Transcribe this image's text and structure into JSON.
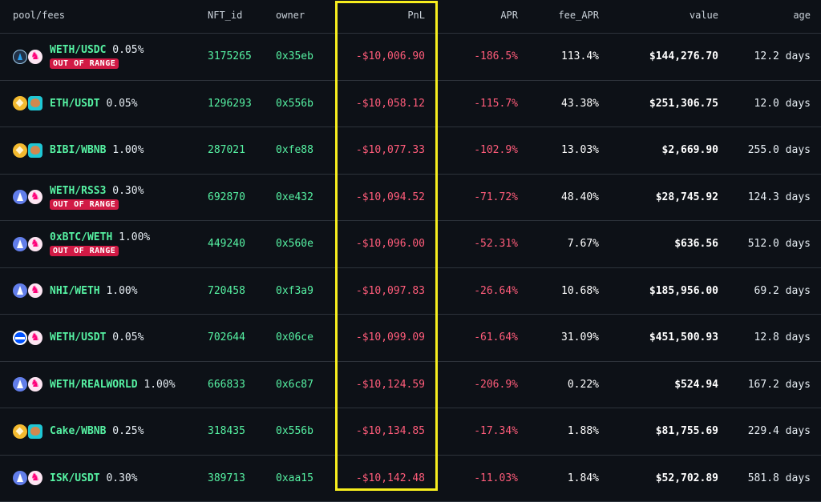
{
  "headers": {
    "pool": "pool/fees",
    "nft_id": "NFT_id",
    "owner": "owner",
    "pnl": "PnL",
    "apr": "APR",
    "fee_apr": "fee_APR",
    "value": "value",
    "age": "age"
  },
  "colors": {
    "accent_green": "#56f2a3",
    "negative_red": "#ff5c7a",
    "badge_red": "#d11a45",
    "highlight_yellow": "#f7ee1e",
    "background": "#0d1117"
  },
  "rows": [
    {
      "icons": [
        "arbitrum-icon",
        "uniswap-icon"
      ],
      "pair": "WETH/USDC",
      "fee": "0.05%",
      "badge": "OUT OF RANGE",
      "nft_id": "3175265",
      "owner": "0x35eb",
      "pnl": "-$10,006.90",
      "apr": "-186.5%",
      "fee_apr": "113.4%",
      "value": "$144,276.70",
      "age": "12.2 days"
    },
    {
      "icons": [
        "bnb-icon",
        "pancakeswap-icon"
      ],
      "pair": "ETH/USDT",
      "fee": "0.05%",
      "badge": "",
      "nft_id": "1296293",
      "owner": "0x556b",
      "pnl": "-$10,058.12",
      "apr": "-115.7%",
      "fee_apr": "43.38%",
      "value": "$251,306.75",
      "age": "12.0 days"
    },
    {
      "icons": [
        "bnb-icon",
        "pancakeswap-icon"
      ],
      "pair": "BIBI/WBNB",
      "fee": "1.00%",
      "badge": "",
      "nft_id": "287021",
      "owner": "0xfe88",
      "pnl": "-$10,077.33",
      "apr": "-102.9%",
      "fee_apr": "13.03%",
      "value": "$2,669.90",
      "age": "255.0 days"
    },
    {
      "icons": [
        "ethereum-icon",
        "uniswap-icon"
      ],
      "pair": "WETH/RSS3",
      "fee": "0.30%",
      "badge": "OUT OF RANGE",
      "nft_id": "692870",
      "owner": "0xe432",
      "pnl": "-$10,094.52",
      "apr": "-71.72%",
      "fee_apr": "48.40%",
      "value": "$28,745.92",
      "age": "124.3 days"
    },
    {
      "icons": [
        "ethereum-icon",
        "uniswap-icon"
      ],
      "pair": "0xBTC/WETH",
      "fee": "1.00%",
      "badge": "OUT OF RANGE",
      "nft_id": "449240",
      "owner": "0x560e",
      "pnl": "-$10,096.00",
      "apr": "-52.31%",
      "fee_apr": "7.67%",
      "value": "$636.56",
      "age": "512.0 days"
    },
    {
      "icons": [
        "ethereum-icon",
        "uniswap-icon"
      ],
      "pair": "NHI/WETH",
      "fee": "1.00%",
      "badge": "",
      "nft_id": "720458",
      "owner": "0xf3a9",
      "pnl": "-$10,097.83",
      "apr": "-26.64%",
      "fee_apr": "10.68%",
      "value": "$185,956.00",
      "age": "69.2 days"
    },
    {
      "icons": [
        "base-icon",
        "uniswap-icon"
      ],
      "pair": "WETH/USDT",
      "fee": "0.05%",
      "badge": "",
      "nft_id": "702644",
      "owner": "0x06ce",
      "pnl": "-$10,099.09",
      "apr": "-61.64%",
      "fee_apr": "31.09%",
      "value": "$451,500.93",
      "age": "12.8 days"
    },
    {
      "icons": [
        "ethereum-icon",
        "uniswap-icon"
      ],
      "pair": "WETH/REALWORLD",
      "fee": "1.00%",
      "badge": "",
      "nft_id": "666833",
      "owner": "0x6c87",
      "pnl": "-$10,124.59",
      "apr": "-206.9%",
      "fee_apr": "0.22%",
      "value": "$524.94",
      "age": "167.2 days"
    },
    {
      "icons": [
        "bnb-icon",
        "pancakeswap-icon"
      ],
      "pair": "Cake/WBNB",
      "fee": "0.25%",
      "badge": "",
      "nft_id": "318435",
      "owner": "0x556b",
      "pnl": "-$10,134.85",
      "apr": "-17.34%",
      "fee_apr": "1.88%",
      "value": "$81,755.69",
      "age": "229.4 days"
    },
    {
      "icons": [
        "ethereum-icon",
        "uniswap-icon"
      ],
      "pair": "ISK/USDT",
      "fee": "0.30%",
      "badge": "",
      "nft_id": "389713",
      "owner": "0xaa15",
      "pnl": "-$10,142.48",
      "apr": "-11.03%",
      "fee_apr": "1.84%",
      "value": "$52,702.89",
      "age": "581.8 days"
    }
  ]
}
